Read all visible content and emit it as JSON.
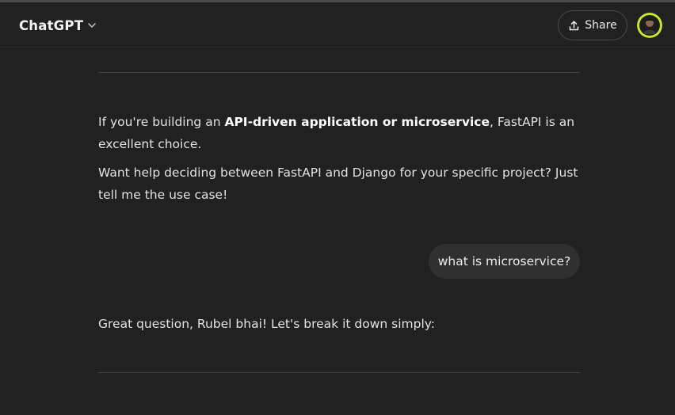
{
  "header": {
    "model_name": "ChatGPT",
    "share_label": "Share"
  },
  "conversation": {
    "assistant_block_1": {
      "p1_prefix": "If you're building an ",
      "p1_bold": "API-driven application or microservice",
      "p1_suffix": ", FastAPI is an excellent choice.",
      "p2": "Want help deciding between FastAPI and Django for your specific project? Just tell me the use case!"
    },
    "user_message": "what is microservice?",
    "assistant_block_2": {
      "p1": "Great question, Rubel bhai! Let's break it down simply:"
    }
  },
  "icons": {
    "model_dropdown": "chevron-down-icon",
    "share": "share-upload-icon",
    "avatar": "user-avatar"
  },
  "colors": {
    "background": "#212121",
    "user_bubble": "#303030",
    "divider": "#424242",
    "avatar_ring": "#c8e630"
  }
}
